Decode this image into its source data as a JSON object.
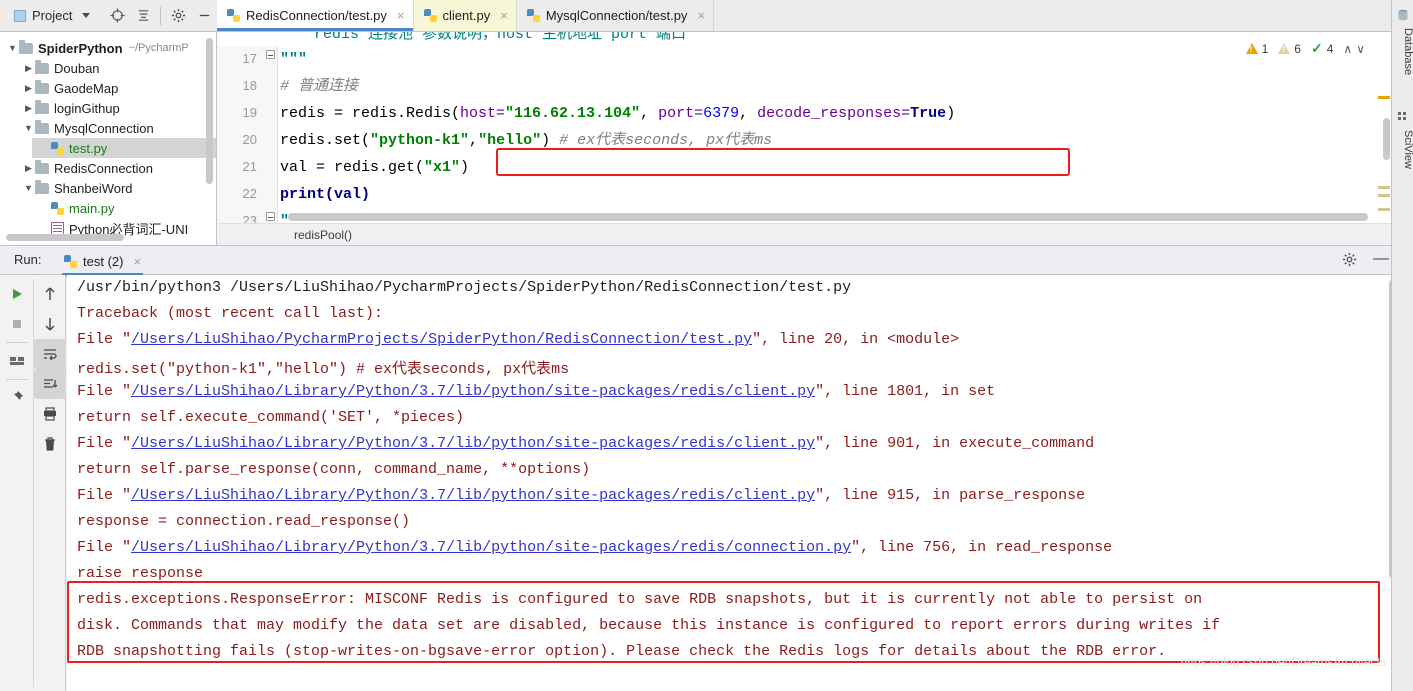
{
  "toolbar": {
    "project_label": "Project",
    "icons": [
      "locate-icon",
      "collapse-all-icon",
      "settings-gear-icon",
      "hide-icon"
    ]
  },
  "tabs": [
    {
      "label": "RedisConnection/test.py",
      "active": true,
      "close": "×"
    },
    {
      "label": "client.py",
      "active": false,
      "close": "×"
    },
    {
      "label": "MysqlConnection/test.py",
      "active": false,
      "close": "×"
    }
  ],
  "project_tree": [
    {
      "label": "SpiderPython",
      "path": "~/PycharmP",
      "depth": 0,
      "twisty": "▼",
      "kind": "folder",
      "bold": true,
      "selected": false
    },
    {
      "label": "Douban",
      "path": "",
      "depth": 1,
      "twisty": "▶",
      "kind": "folder",
      "bold": false,
      "selected": false
    },
    {
      "label": "GaodeMap",
      "path": "",
      "depth": 1,
      "twisty": "▶",
      "kind": "folder",
      "bold": false,
      "selected": false
    },
    {
      "label": "loginGithup",
      "path": "",
      "depth": 1,
      "twisty": "▶",
      "kind": "folder",
      "bold": false,
      "selected": false
    },
    {
      "label": "MysqlConnection",
      "path": "",
      "depth": 1,
      "twisty": "▼",
      "kind": "folder",
      "bold": false,
      "selected": false
    },
    {
      "label": "test.py",
      "path": "",
      "depth": 2,
      "twisty": "",
      "kind": "python",
      "bold": false,
      "selected": true
    },
    {
      "label": "RedisConnection",
      "path": "",
      "depth": 1,
      "twisty": "▶",
      "kind": "folder",
      "bold": false,
      "selected": false
    },
    {
      "label": "ShanbeiWord",
      "path": "",
      "depth": 1,
      "twisty": "▼",
      "kind": "folder",
      "bold": false,
      "selected": false
    },
    {
      "label": "main.py",
      "path": "",
      "depth": 2,
      "twisty": "",
      "kind": "python",
      "bold": false,
      "selected": false
    },
    {
      "label": "Python必背词汇-UNI",
      "path": "",
      "depth": 2,
      "twisty": "",
      "kind": "doc",
      "bold": false,
      "selected": false
    }
  ],
  "editor": {
    "line_numbers": [
      "17",
      "18",
      "19",
      "20",
      "21",
      "22",
      "23"
    ],
    "lines": [
      {
        "n": "17",
        "tokens": [
          {
            "t": "\"\"\"",
            "c": "k-trip"
          }
        ]
      },
      {
        "n": "18",
        "tokens": [
          {
            "t": "# 普通连接",
            "c": "k-cmt"
          }
        ]
      },
      {
        "n": "19",
        "tokens": [
          {
            "t": "redis = redis.Redis(",
            "c": "k-plain"
          },
          {
            "t": "host=",
            "c": "k-kwarg"
          },
          {
            "t": "\"116.62.13.104\"",
            "c": "k-str"
          },
          {
            "t": ", ",
            "c": "k-plain"
          },
          {
            "t": "port=",
            "c": "k-kwarg"
          },
          {
            "t": "6379",
            "c": "k-num"
          },
          {
            "t": ", ",
            "c": "k-plain"
          },
          {
            "t": "decode_responses=",
            "c": "k-kwarg"
          },
          {
            "t": "True",
            "c": "k-kw"
          },
          {
            "t": ")",
            "c": "k-plain"
          }
        ]
      },
      {
        "n": "20",
        "tokens": [
          {
            "t": "redis.set(",
            "c": "k-plain"
          },
          {
            "t": "\"python-k1\"",
            "c": "k-str"
          },
          {
            "t": ",",
            "c": "k-plain"
          },
          {
            "t": "\"hello\"",
            "c": "k-str"
          },
          {
            "t": ")",
            "c": "k-plain"
          },
          {
            "t": " # ex代表seconds, px代表ms",
            "c": "k-cmt"
          }
        ]
      },
      {
        "n": "21",
        "tokens": [
          {
            "t": "val = redis.get(",
            "c": "k-plain"
          },
          {
            "t": "\"x1\"",
            "c": "k-str"
          },
          {
            "t": ")",
            "c": "k-plain"
          }
        ]
      },
      {
        "n": "22",
        "tokens": [
          {
            "t": "print(val)",
            "c": "k-kw"
          }
        ]
      },
      {
        "n": "23",
        "tokens": [
          {
            "t": "\"\"\"",
            "c": "k-trip"
          }
        ]
      }
    ],
    "breadcrumb": "redisPool()",
    "inspections": {
      "error_count": "1",
      "warning_count": "6",
      "ok_count": "4",
      "prev_arrow": "∧",
      "next_arrow": "∨"
    }
  },
  "run_panel": {
    "label": "Run:",
    "tab_label": "test (2)",
    "tab_close": "×",
    "gear": "gear-icon",
    "minimize": "—",
    "tools_left": [
      "rerun-play-icon",
      "stop-icon",
      "layout-icon",
      "pin-icon"
    ],
    "tools_right": [
      "up-arrow-icon",
      "down-arrow-icon",
      "soft-wrap-icon",
      "scroll-to-end-icon",
      "print-icon",
      "trash-icon"
    ]
  },
  "console": {
    "lines": [
      {
        "segments": [
          {
            "t": "/usr/bin/python3 /Users/LiuShihao/PycharmProjects/SpiderPython/RedisConnection/test.py",
            "c": "c-dark"
          }
        ]
      },
      {
        "segments": [
          {
            "t": "Traceback (most recent call last):",
            "c": "c-err"
          }
        ]
      },
      {
        "segments": [
          {
            "t": "  File \"",
            "c": "c-err"
          },
          {
            "t": "/Users/LiuShihao/PycharmProjects/SpiderPython/RedisConnection/test.py",
            "c": "c-link"
          },
          {
            "t": "\", line 20, in <module>",
            "c": "c-err"
          }
        ]
      },
      {
        "segments": [
          {
            "t": "    redis.set(\"python-k1\",\"hello\") # ex代表seconds, px代表ms",
            "c": "c-err"
          }
        ]
      },
      {
        "segments": [
          {
            "t": "  File \"",
            "c": "c-err"
          },
          {
            "t": "/Users/LiuShihao/Library/Python/3.7/lib/python/site-packages/redis/client.py",
            "c": "c-link"
          },
          {
            "t": "\", line 1801, in set",
            "c": "c-err"
          }
        ]
      },
      {
        "segments": [
          {
            "t": "    return self.execute_command('SET', *pieces)",
            "c": "c-err"
          }
        ]
      },
      {
        "segments": [
          {
            "t": "  File \"",
            "c": "c-err"
          },
          {
            "t": "/Users/LiuShihao/Library/Python/3.7/lib/python/site-packages/redis/client.py",
            "c": "c-link"
          },
          {
            "t": "\", line 901, in execute_command",
            "c": "c-err"
          }
        ]
      },
      {
        "segments": [
          {
            "t": "    return self.parse_response(conn, command_name, **options)",
            "c": "c-err"
          }
        ]
      },
      {
        "segments": [
          {
            "t": "  File \"",
            "c": "c-err"
          },
          {
            "t": "/Users/LiuShihao/Library/Python/3.7/lib/python/site-packages/redis/client.py",
            "c": "c-link"
          },
          {
            "t": "\", line 915, in parse_response",
            "c": "c-err"
          }
        ]
      },
      {
        "segments": [
          {
            "t": "    response = connection.read_response()",
            "c": "c-err"
          }
        ]
      },
      {
        "segments": [
          {
            "t": "  File \"",
            "c": "c-err"
          },
          {
            "t": "/Users/LiuShihao/Library/Python/3.7/lib/python/site-packages/redis/connection.py",
            "c": "c-link"
          },
          {
            "t": "\", line 756, in read_response",
            "c": "c-err"
          }
        ]
      },
      {
        "segments": [
          {
            "t": "    raise response",
            "c": "c-err"
          }
        ]
      }
    ],
    "error_block": [
      "redis.exceptions.ResponseError: MISCONF Redis is configured to save RDB snapshots, but it is currently not able to persist on",
      "  disk. Commands that may modify the data set are disabled, because this instance is configured to report errors during writes if",
      "  RDB snapshotting fails (stop-writes-on-bgsave-error option). Please check the Redis logs for details about the RDB error."
    ],
    "watermark": "https://blog.csdn.net/DreamsArchitects"
  },
  "right_rail": [
    {
      "label": "Database",
      "icon": "database-icon"
    },
    {
      "label": "SciView",
      "icon": "sciview-icon"
    }
  ],
  "colors": {
    "accent_blue": "#4a86c8",
    "error_red": "#ef1c1c",
    "console_error": "#8b1a1a",
    "link_blue": "#3333cc",
    "string_green": "#008000",
    "keyword_navy": "#000080",
    "kwarg_purple": "#660099",
    "comment_gray": "#808080",
    "number_blue": "#0000ff",
    "triple_quote_teal": "#008080"
  }
}
